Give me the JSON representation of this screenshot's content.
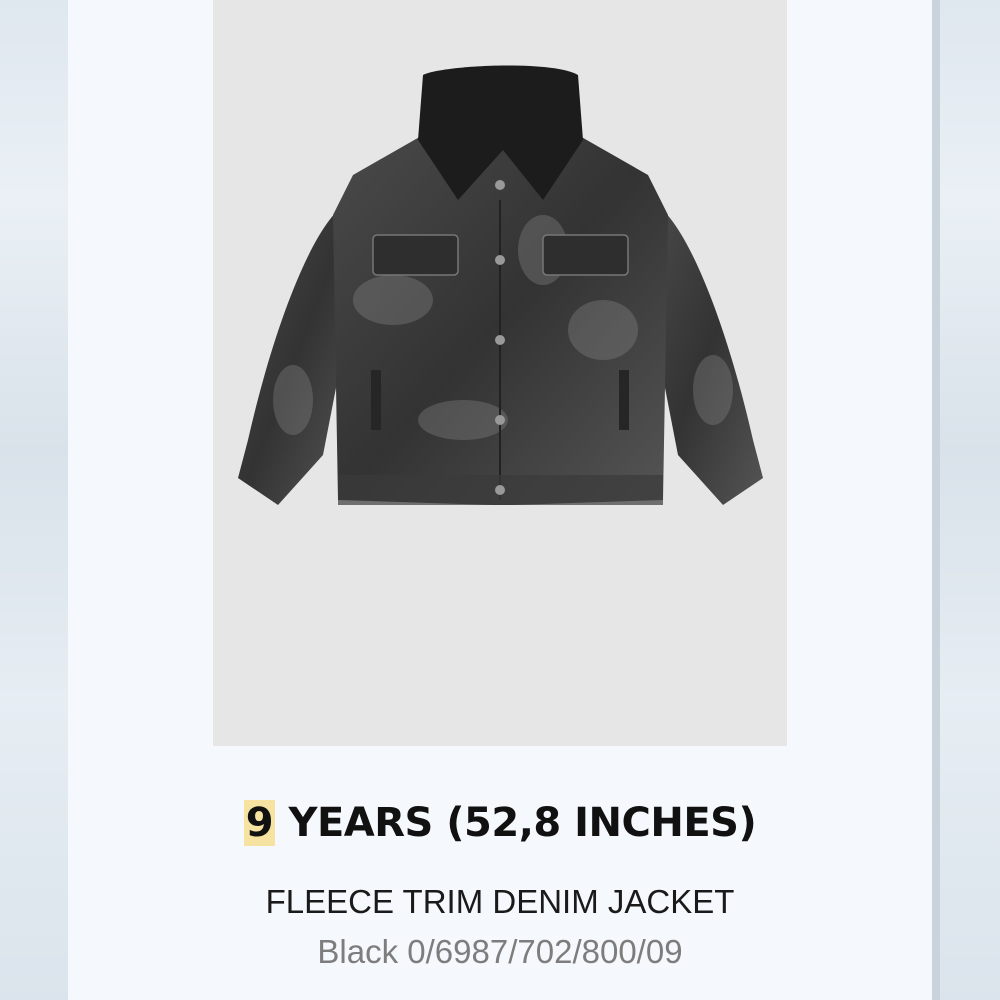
{
  "product": {
    "size_number": "9",
    "size_rest": " YEARS (52,8 INCHES)",
    "name": "FLEECE TRIM DENIM JACKET",
    "color_ref": "Black 0/6987/702/800/09"
  },
  "colors": {
    "highlight": "#f7e3a1",
    "photo_background": "#e6e6e6",
    "denim": "#3e3e3e",
    "collar": "#1c1c1c"
  }
}
